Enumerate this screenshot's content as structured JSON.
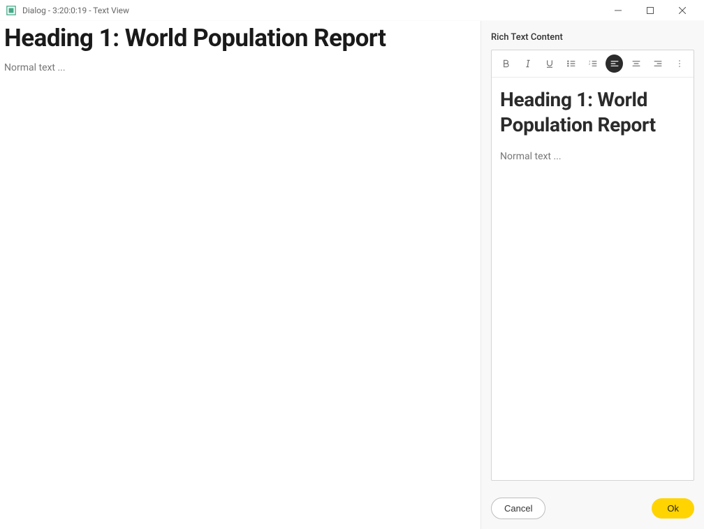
{
  "window": {
    "title": "Dialog - 3:20:0:19 - Text View"
  },
  "leftPane": {
    "heading": "Heading 1: World Population Report",
    "normal": "Normal text ..."
  },
  "rightPane": {
    "label": "Rich Text Content",
    "editor": {
      "heading": "Heading 1: World Population Report",
      "normal": "Normal text ..."
    }
  },
  "buttons": {
    "cancel": "Cancel",
    "ok": "Ok"
  },
  "toolbar": {
    "activeAlign": "left",
    "icons": [
      "bold",
      "italic",
      "underline",
      "list-unordered",
      "list-ordered",
      "align-left",
      "align-center",
      "align-right",
      "more"
    ]
  }
}
